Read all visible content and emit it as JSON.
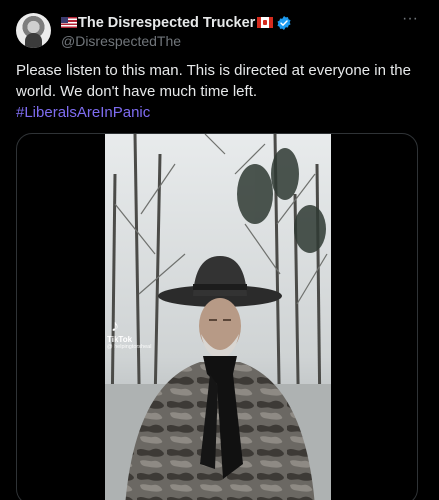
{
  "post": {
    "display_name": "The Disrespected Trucker",
    "handle": "@DisrespectedThe",
    "text": "Please listen to this man. This is directed at everyone in the world. We don't have much time left.",
    "hashtag": "#LiberalsAreInPanic",
    "more_icon": "more-icon"
  },
  "video": {
    "watermark_label": "TikTok",
    "watermark_user": "@ helpingtorsheal"
  },
  "colors": {
    "background": "#000000",
    "text": "#e7e9ea",
    "secondary": "#71767b",
    "link": "#7e6cf0",
    "verified": "#1d9bf0"
  }
}
